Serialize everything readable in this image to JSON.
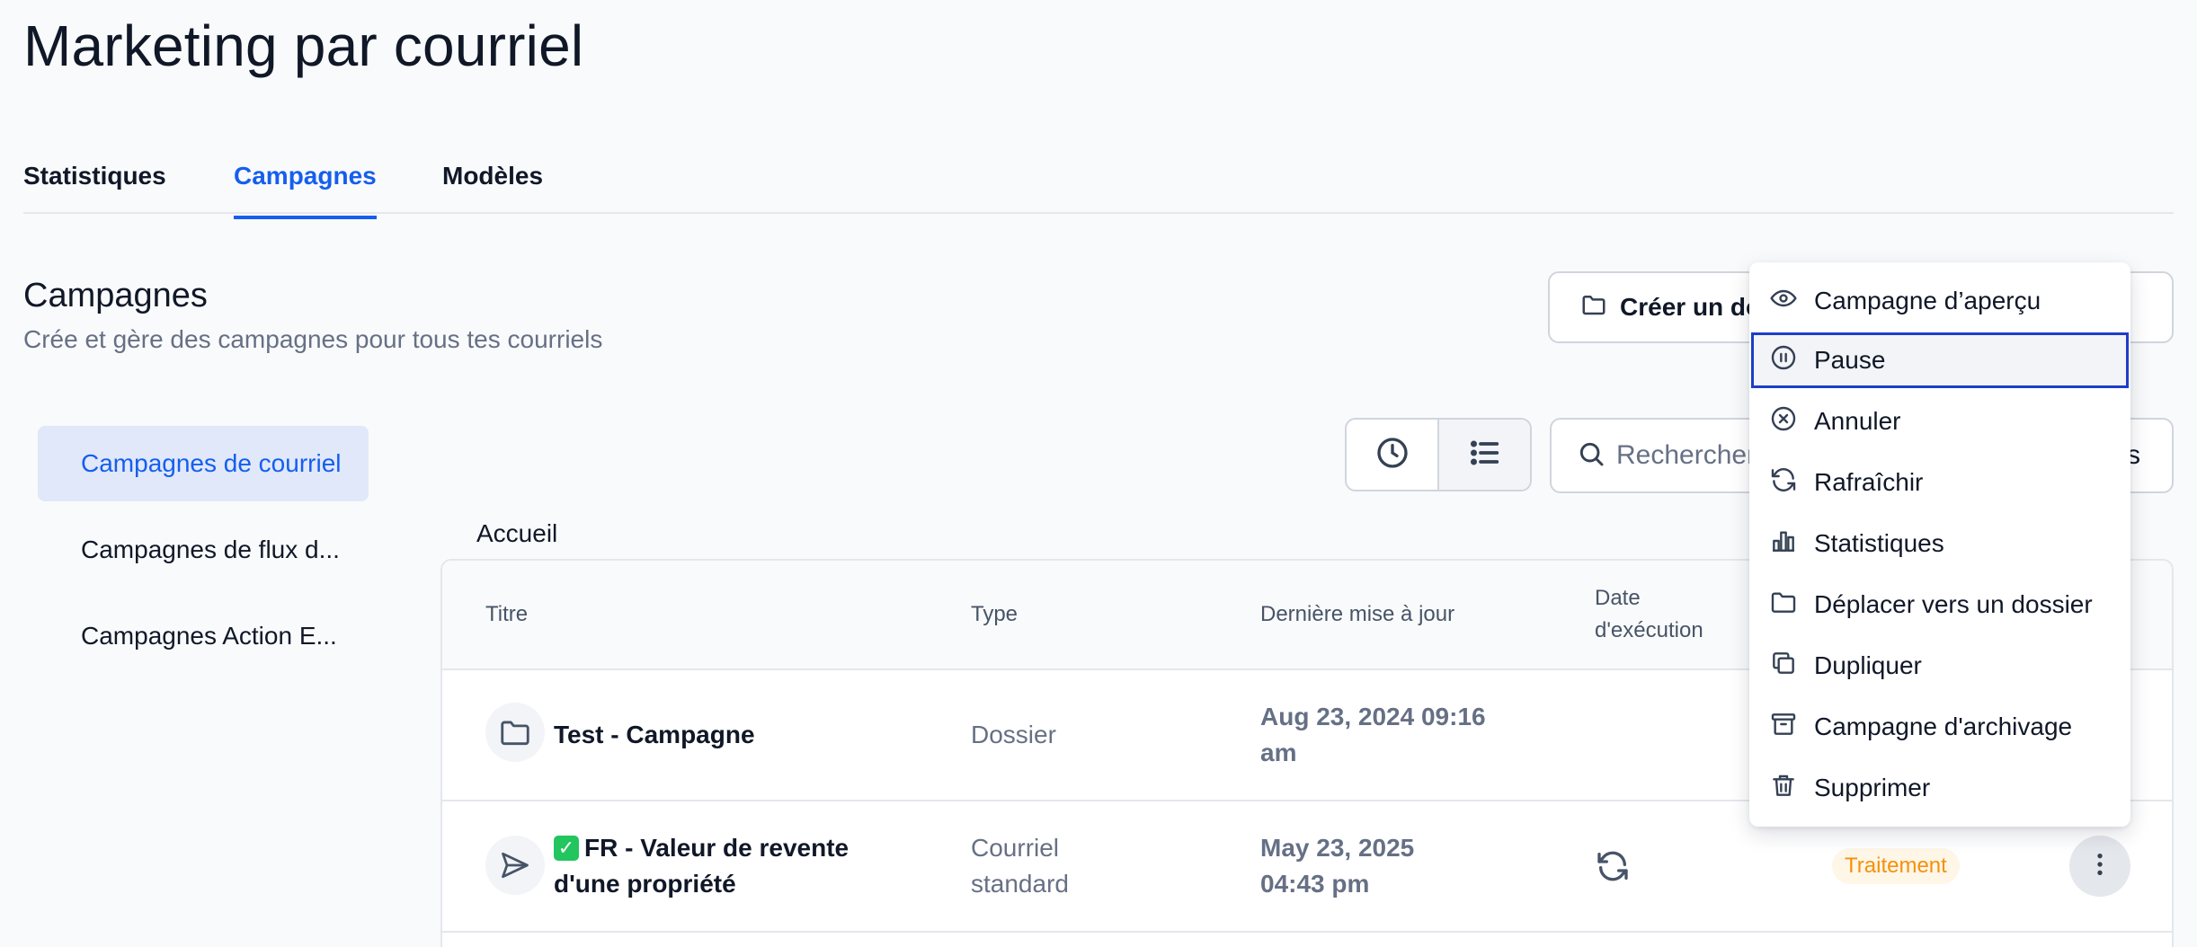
{
  "page": {
    "title": "Marketing par courriel"
  },
  "tabs": [
    {
      "label": "Statistiques"
    },
    {
      "label": "Campagnes"
    },
    {
      "label": "Modèles"
    }
  ],
  "section": {
    "title": "Campagnes",
    "subtitle": "Crée et gère des campagnes pour tous tes courriels"
  },
  "toolbar": {
    "create_folder_label": "Créer un dossier",
    "search_placeholder": "Rechercher",
    "search_tail": "s"
  },
  "sidebar": {
    "items": [
      {
        "label": "Campagnes de courriel"
      },
      {
        "label": "Campagnes de flux d..."
      },
      {
        "label": "Campagnes Action E..."
      }
    ]
  },
  "breadcrumb": "Accueil",
  "table": {
    "headers": {
      "title": "Titre",
      "type": "Type",
      "updated": "Dernière mise à jour",
      "exec_line1": "Date",
      "exec_line2": "d'exécution"
    },
    "rows": [
      {
        "icon": "folder-icon",
        "title": "Test - Campagne",
        "type": "Dossier",
        "updated_line1": "Aug 23, 2024 09:16",
        "updated_line2": "am"
      },
      {
        "icon": "send-icon",
        "check": "✓",
        "title_line1": "FR - Valeur de revente",
        "title_line2": "d'une propriété",
        "type_line1": "Courriel",
        "type_line2": "standard",
        "updated_line1": "May 23, 2025",
        "updated_line2": "04:43 pm",
        "exec_icon": "refresh-icon",
        "status": "Traitement"
      }
    ]
  },
  "menu": {
    "items": [
      {
        "label": "Campagne d’aperçu",
        "icon": "eye-icon"
      },
      {
        "label": "Pause",
        "icon": "pause-circle-icon"
      },
      {
        "label": "Annuler",
        "icon": "x-circle-icon"
      },
      {
        "label": "Rafraîchir",
        "icon": "refresh-icon"
      },
      {
        "label": "Statistiques",
        "icon": "bar-chart-icon"
      },
      {
        "label": "Déplacer vers un dossier",
        "icon": "folder-icon"
      },
      {
        "label": "Dupliquer",
        "icon": "copy-icon"
      },
      {
        "label": "Campagne d'archivage",
        "icon": "archive-icon"
      },
      {
        "label": "Supprimer",
        "icon": "trash-icon"
      }
    ]
  },
  "colors": {
    "accent": "#155eef",
    "status_bg": "#fef6e7",
    "status_text": "#f79009",
    "focus_ring": "#1d3ec7"
  }
}
